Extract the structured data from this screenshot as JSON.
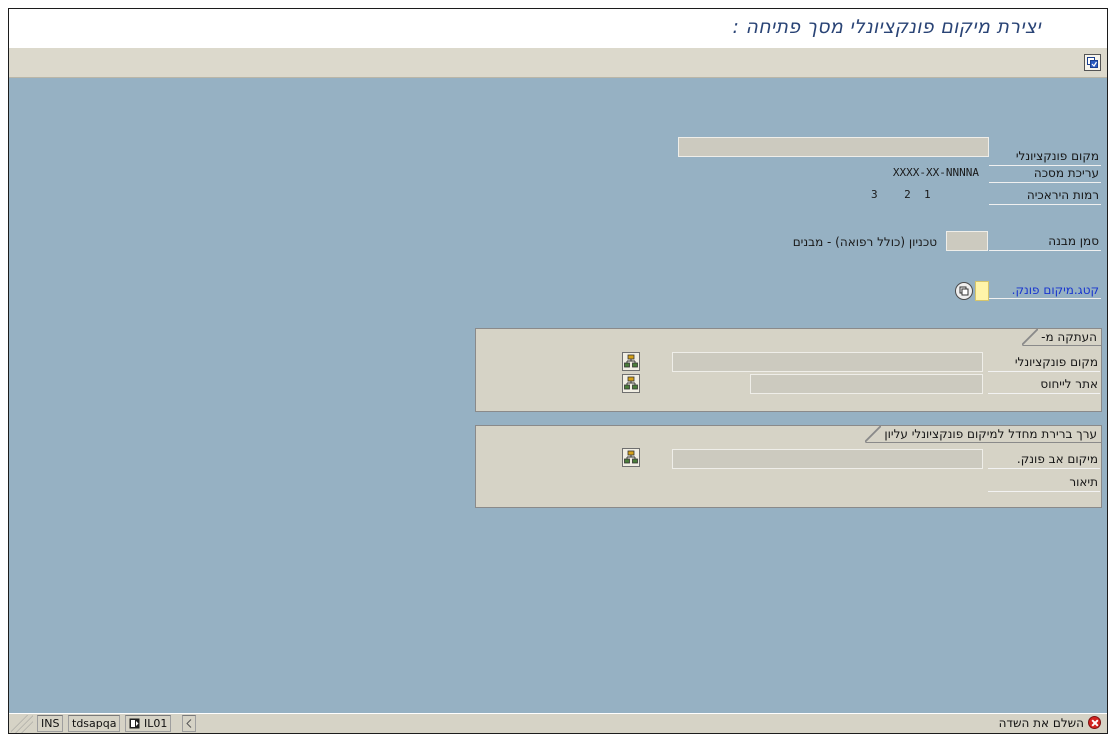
{
  "window": {
    "title": "יצירת מיקום פונקציונלי מסך פתיחה :"
  },
  "form": {
    "functional_location_label": "מקום פונקציונלי",
    "edit_mask_label": "עריכת מסכה",
    "edit_mask_value": "XXXX-XX-NNNNA",
    "hierarchy_levels_label": "רמות היראכיה",
    "hierarchy_levels_value": "3    2  1",
    "structure_indicator_label": "סמן מבנה",
    "structure_indicator_text": "טכניון (כולל רפואה) - מבנים",
    "category_label": "קטג.מיקום פונק."
  },
  "copy_from": {
    "title": "העתקה מ-",
    "functional_location_label": "מקום פונקציונלי",
    "reference_site_label": "אתר לייחוס"
  },
  "default_superior": {
    "title": "ערך ברירת מחדל למיקום פונקציונלי עליון",
    "superior_location_label": "מיקום אב פונק.",
    "description_label": "תיאור"
  },
  "status_bar": {
    "message": "השלם את השדה",
    "mode": "INS",
    "server": "tdsapqa",
    "client": "IL01"
  }
}
